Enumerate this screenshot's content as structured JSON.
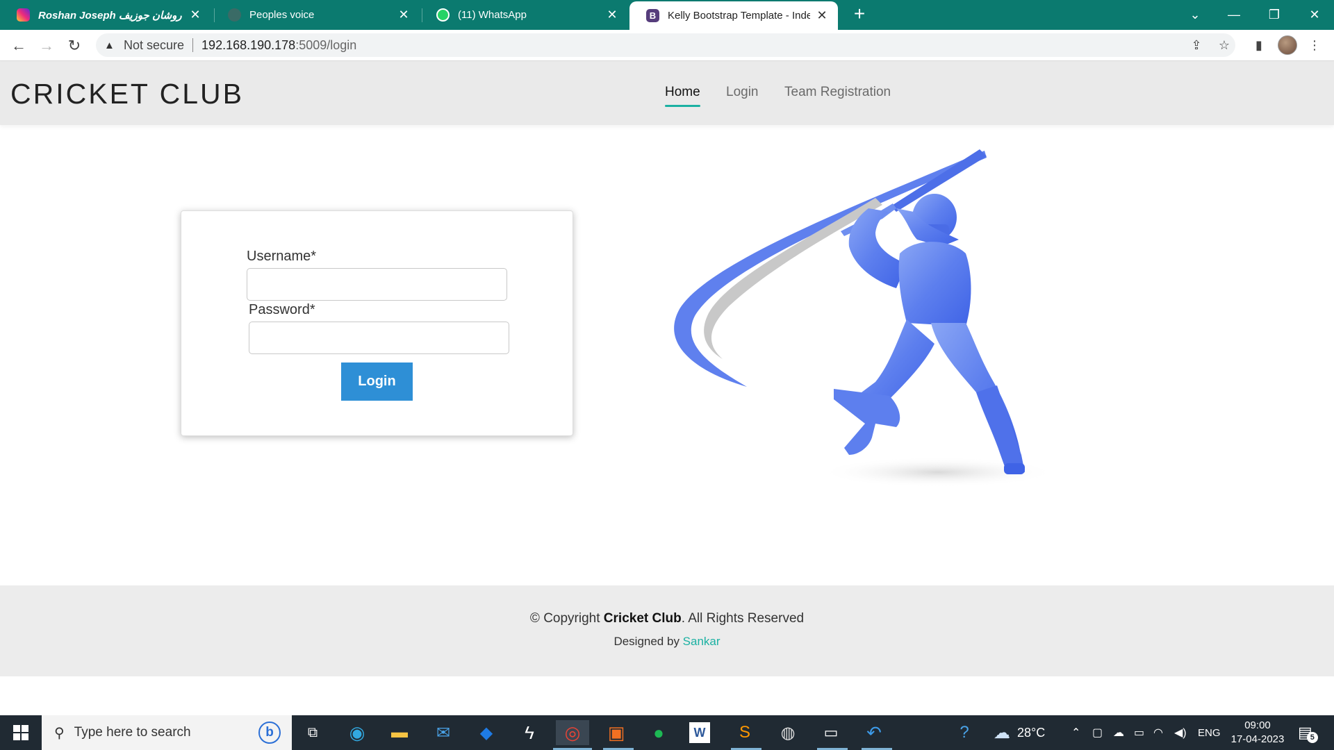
{
  "browser": {
    "tabs": [
      {
        "title": "Roshan Joseph روشان جوزيف 🤍",
        "icon": "instagram-icon",
        "active": false
      },
      {
        "title": "Peoples voice",
        "icon": "globe-icon",
        "active": false
      },
      {
        "title": "(11) WhatsApp",
        "icon": "whatsapp-icon",
        "active": false
      },
      {
        "title": "Kelly Bootstrap Template - Index",
        "icon": "bootstrap-icon",
        "active": true
      }
    ],
    "security_label": "Not secure",
    "url_host": "192.168.190.178",
    "url_rest": ":5009/login",
    "colors": {
      "tabbar": "#0b7a6f"
    }
  },
  "site": {
    "logo": "CRICKET CLUB",
    "nav": [
      {
        "label": "Home",
        "active": true
      },
      {
        "label": "Login",
        "active": false
      },
      {
        "label": "Team Registration",
        "active": false
      }
    ],
    "accent": "#1bb1a2"
  },
  "login_form": {
    "username_label": "Username*",
    "password_label": "Password*",
    "username_value": "",
    "password_value": "",
    "submit_label": "Login",
    "button_color": "#2e8fd6"
  },
  "hero": {
    "icon": "cricket-batsman-illustration"
  },
  "footer": {
    "copyright_prefix": "© Copyright ",
    "copyright_brand": "Cricket Club",
    "copyright_suffix": ". All Rights Reserved",
    "designed_prefix": "Designed by ",
    "designed_link": "Sankar"
  },
  "taskbar": {
    "search_placeholder": "Type here to search",
    "weather": "28°C",
    "language": "ENG",
    "time": "09:00",
    "date": "17-04-2023",
    "notifications": "5"
  }
}
